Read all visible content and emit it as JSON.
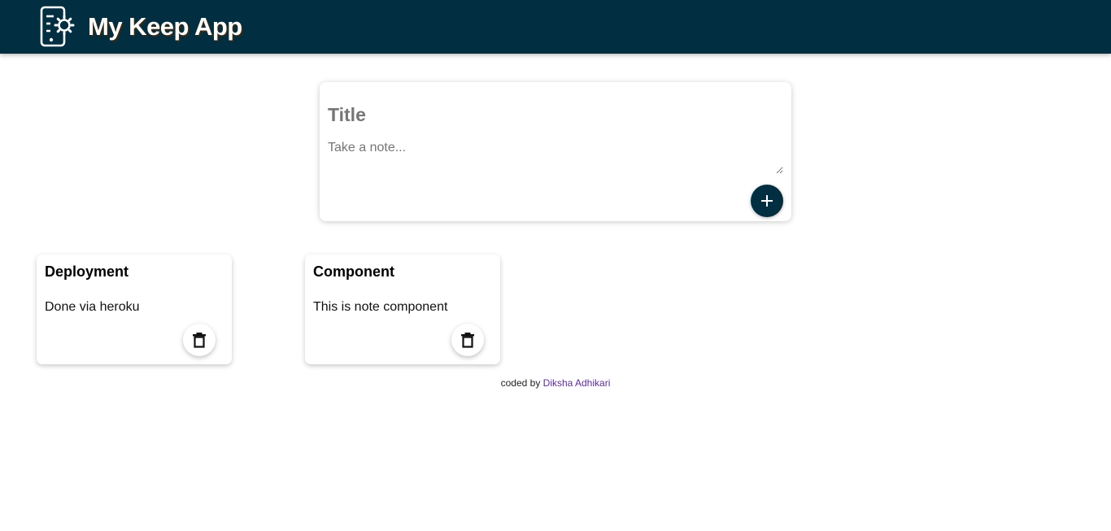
{
  "header": {
    "app_title": "My Keep App",
    "logo_icon": "phone-settings-icon",
    "background_color": "#012e40"
  },
  "create_note": {
    "title_placeholder": "Title",
    "content_placeholder": "Take a note...",
    "add_icon": "plus-icon"
  },
  "notes": [
    {
      "title": "Deployment",
      "content": "Done via heroku",
      "delete_icon": "trash-icon"
    },
    {
      "title": "Component",
      "content": "This is note component",
      "delete_icon": "trash-icon"
    }
  ],
  "footer": {
    "prefix": "coded by",
    "author": "Diksha Adhikari",
    "link_color": "#5b2d8e"
  }
}
